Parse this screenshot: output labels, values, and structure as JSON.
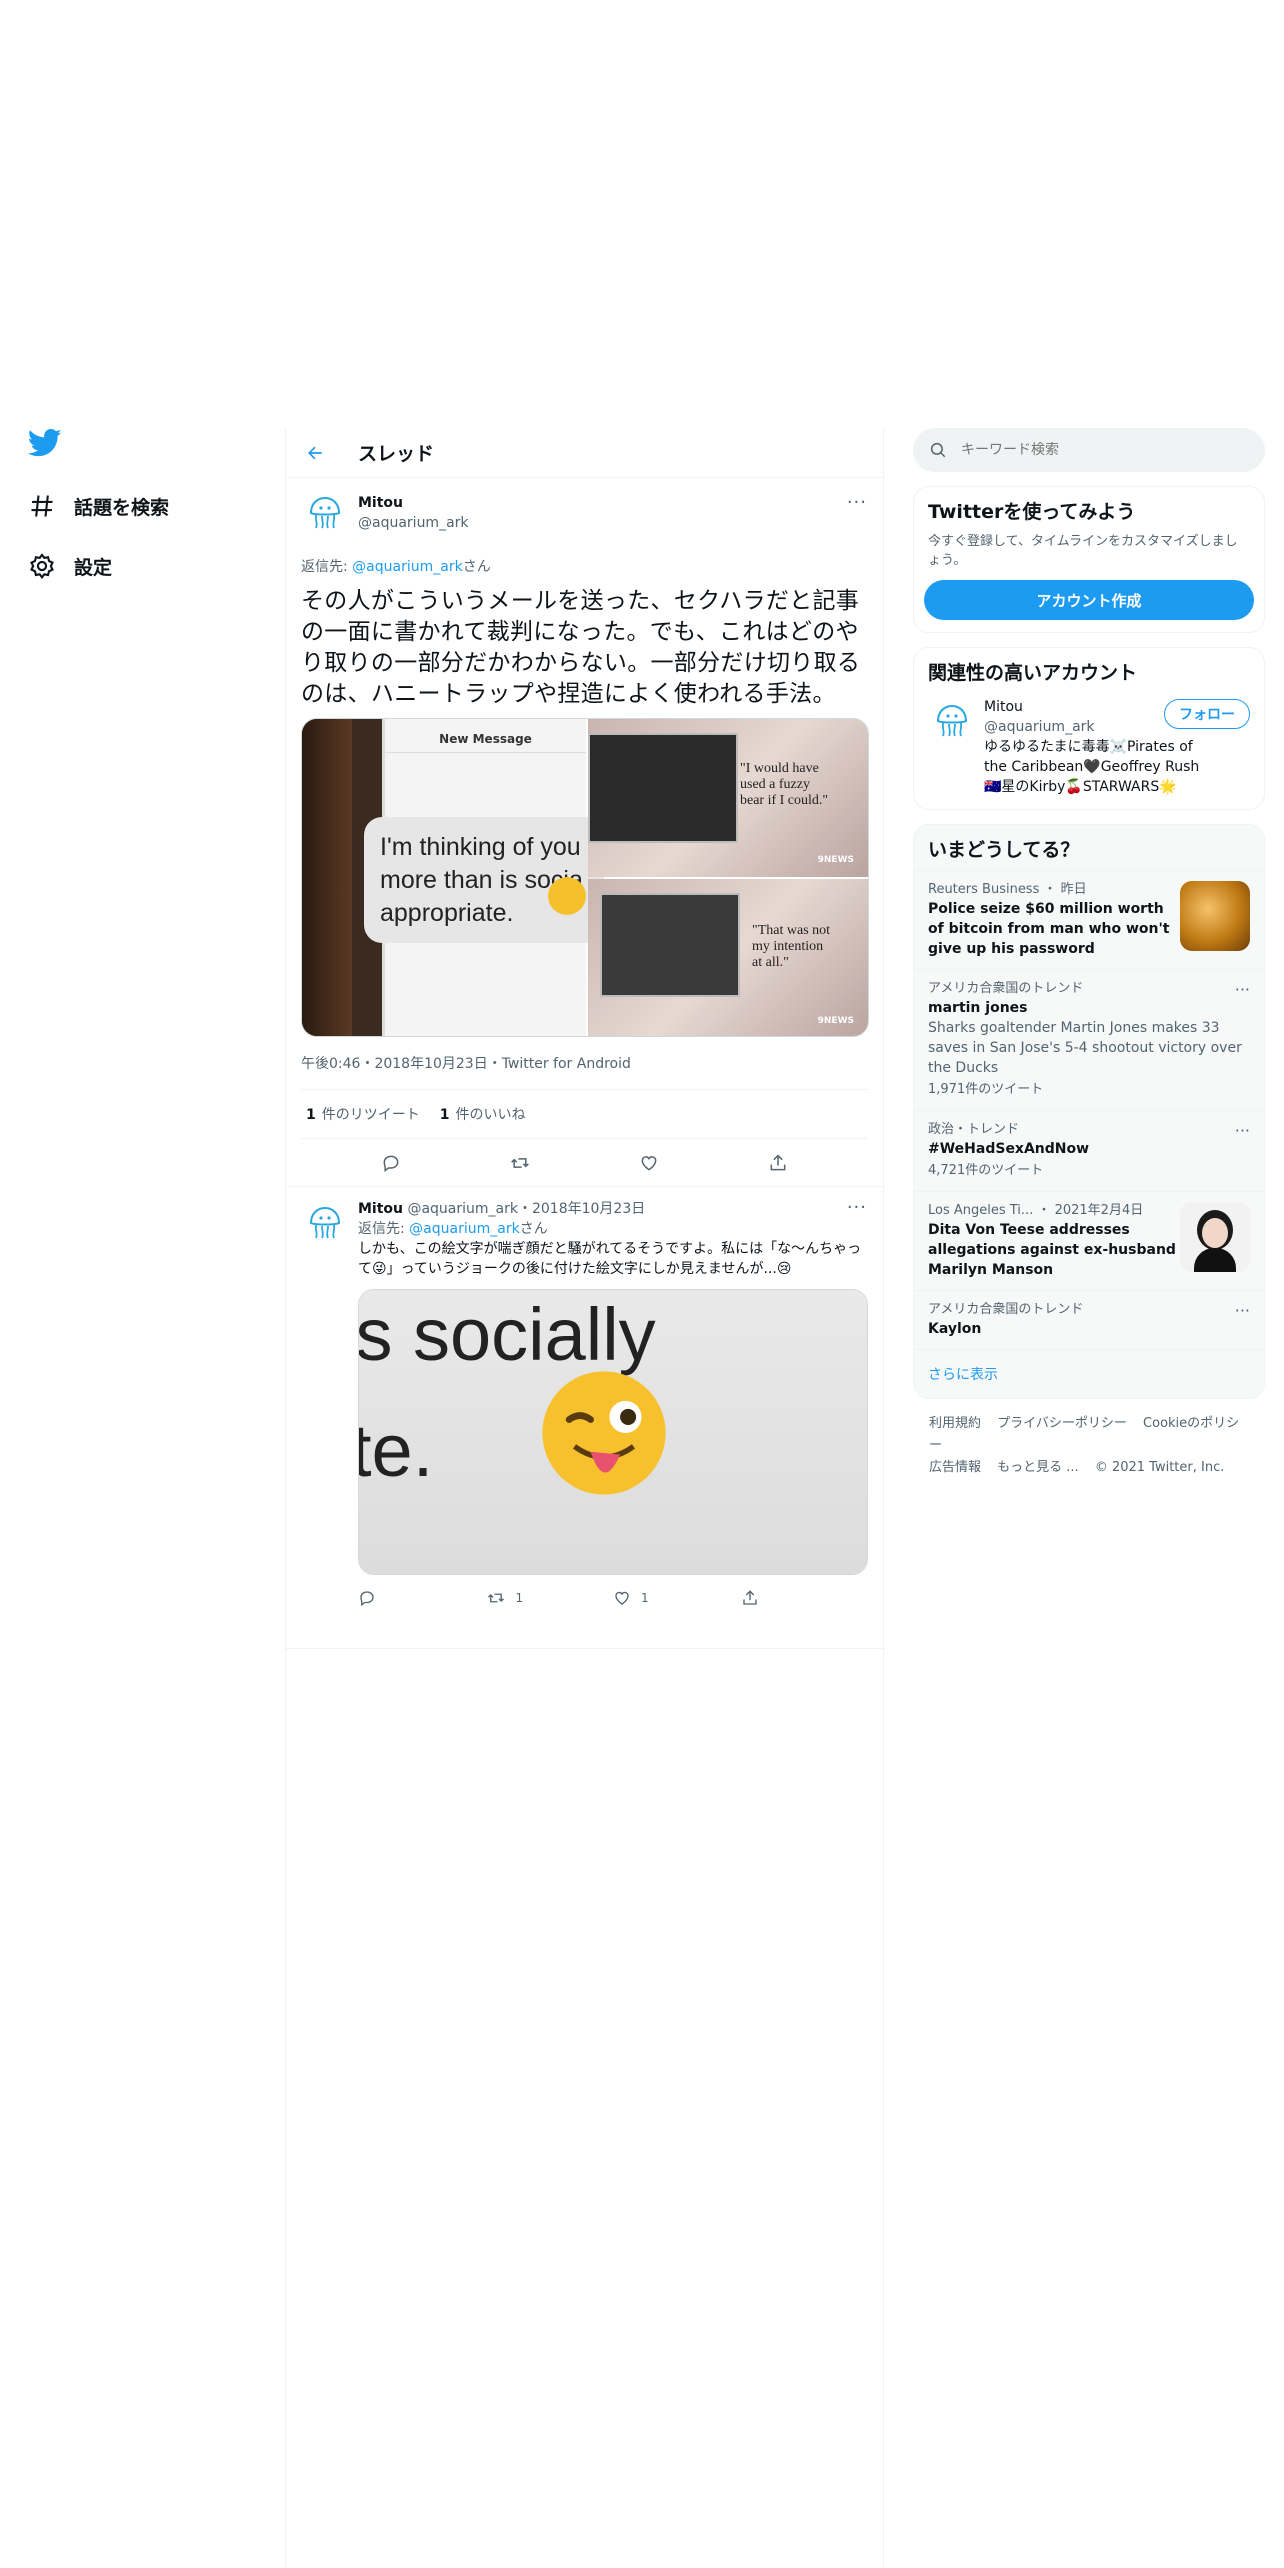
{
  "nav": {
    "logo": "twitter-bird-icon",
    "items": [
      {
        "label": "話題を検索",
        "icon": "hashtag-icon"
      },
      {
        "label": "設定",
        "icon": "gear-icon"
      }
    ]
  },
  "thread": {
    "title": "スレッド",
    "main": {
      "name": "Mitou",
      "handle": "@aquarium_ark",
      "reply_prefix": "返信先: ",
      "reply_handle": "@aquarium_ark",
      "reply_suffix": "さん",
      "text": "その人がこういうメールを送った、セクハラだと記事の一面に書かれて裁判になった。でも、これはどのやり取りの一部分だかわからない。一部分だけ切り取るのは、ハニートラップや捏造によく使われる手法。",
      "media": {
        "compose_header": "New Message",
        "message": [
          "I'm thinking of you",
          "more than is socia",
          "appropriate."
        ],
        "quote1": [
          "\"I would have",
          "used a fuzzy",
          "bear if I could.\""
        ],
        "quote2": [
          "\"That was not",
          "my intention",
          "at all.\""
        ],
        "watermark": "9NEWS"
      },
      "meta": "午後0:46・2018年10月23日・Twitter for Android",
      "retweets_count": "1",
      "retweets_label": "件のリツイート",
      "likes_count": "1",
      "likes_label": "件のいいね"
    },
    "reply": {
      "name": "Mitou",
      "handle_date": "@aquarium_ark・2018年10月23日",
      "reply_prefix": "返信先: ",
      "reply_handle": "@aquarium_ark",
      "reply_suffix": "さん",
      "text": "しかも、この絵文字が喘ぎ顔だと騒がれてるそうですよ。私には「な〜んちゃって😜」っていうジョークの後に付けた絵文字にしか見えませんが...😢",
      "media_text": [
        "is socially",
        "te."
      ],
      "retweet_count": "1",
      "like_count": "1"
    }
  },
  "sidebar": {
    "search_placeholder": "キーワード検索",
    "signup": {
      "title": "Twitterを使ってみよう",
      "desc": "今すぐ登録して、タイムラインをカスタマイズしましょう。",
      "button": "アカウント作成"
    },
    "relevant": {
      "title": "関連性の高いアカウント",
      "name": "Mitou",
      "handle": "@aquarium_ark",
      "bio": "ゆるゆるたまに毒毒☠️Pirates of the Caribbean🖤Geoffrey Rush🇦🇺星のKirby🍒STARWARS🌟",
      "follow": "フォロー"
    },
    "trends": {
      "title": "いまどうしてる？",
      "items": [
        {
          "meta": "Reuters Business ・ 昨日",
          "title": "Police seize $60 million worth of bitcoin from man who won't give up his password"
        },
        {
          "meta": "アメリカ合衆国のトレンド",
          "title": "martin jones",
          "sub": "Sharks goaltender Martin Jones makes 33 saves in San Jose's 5-4 shootout victory over the Ducks",
          "count": "1,971件のツイート"
        },
        {
          "meta": "政治・トレンド",
          "title": "#WeHadSexAndNow",
          "count": "4,721件のツイート"
        },
        {
          "meta": "Los Angeles Ti... ・ 2021年2月4日",
          "title": "Dita Von Teese addresses allegations against ex-husband Marilyn Manson"
        },
        {
          "meta": "アメリカ合衆国のトレンド",
          "title": "Kaylon"
        }
      ],
      "show_more": "さらに表示"
    },
    "footer": {
      "line1": [
        "利用規約",
        "プライバシーポリシー",
        "Cookieのポリシー"
      ],
      "line2": [
        "広告情報",
        "もっと見る ...",
        "© 2021 Twitter, Inc."
      ]
    }
  },
  "colors": {
    "accent": "#1d9bf0",
    "text": "#0f1419",
    "muted": "#536471",
    "border": "#eff3f4"
  }
}
